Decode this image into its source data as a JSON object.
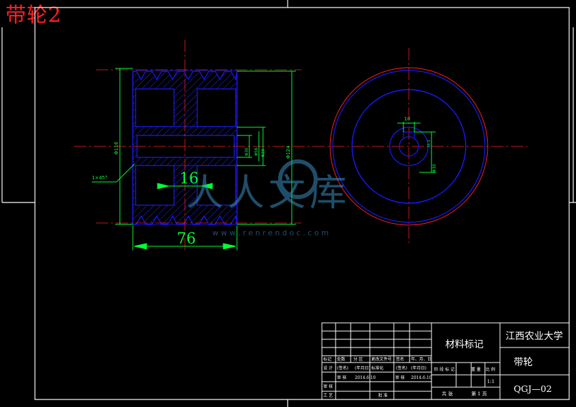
{
  "sheet_title": "带轮2",
  "colors": {
    "background": "#000000",
    "frame": "#ffffff",
    "outline": "#1a1aff",
    "dimension": "#00ff33",
    "centerline": "#ff2020",
    "hatch": "#2a2aff",
    "title_text": "#ff2020",
    "watermark": "#3a8fc0"
  },
  "front_view": {
    "dim_width": "76",
    "dim_hub": "16",
    "dim_outer_dia": "Φ116",
    "dim_right_dia": "Φ124",
    "dim_inner_1": "Φ30",
    "dim_inner_2": "Φ56",
    "dim_inner_3": "Φ28",
    "chamfer": "1×45°"
  },
  "side_view": {
    "keyway_width": "10",
    "keyway_depth": "33.3",
    "bore_dia": "Φ30"
  },
  "watermark": {
    "brand": "人人文库",
    "url": "w w w . r e n r e n d o c . c o m"
  },
  "title_block": {
    "material_label": "材料标记",
    "school": "江西农业大学",
    "part_name": "带轮",
    "drawing_no": "QGJ—02",
    "scale": "1:1",
    "sheet_total": "共 张",
    "sheet_index": "第 1 页",
    "header_labels": [
      "标记",
      "处数",
      "分 区",
      "更改文件号",
      "签名",
      "年、月、日"
    ],
    "row_design": [
      "设 计",
      "(签名)",
      "(年月日)",
      "标准化",
      "(签名)",
      "(年月日)"
    ],
    "row_review": [
      "审 核",
      "",
      "",
      "",
      "",
      ""
    ],
    "row_process": [
      "工 艺",
      "",
      "",
      "批 准",
      "",
      ""
    ],
    "stage_labels": [
      "阶 段 标 记",
      "重 量",
      "比 例"
    ],
    "date_1": "2014.6.10",
    "date_2": "2014.6.10",
    "review_label": "审 核"
  }
}
